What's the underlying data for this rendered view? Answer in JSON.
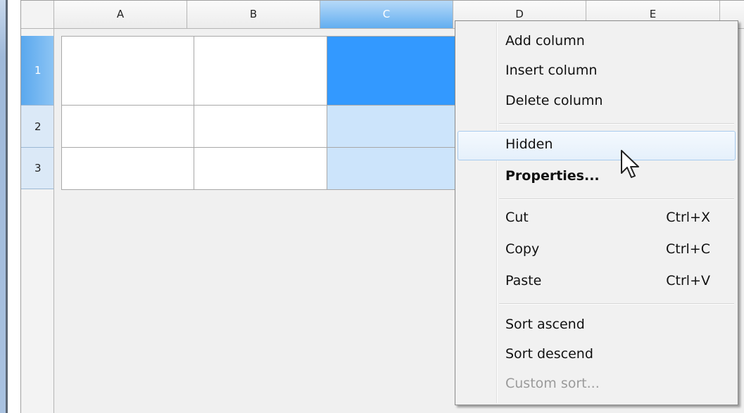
{
  "columns": [
    {
      "label": "A",
      "selected": false
    },
    {
      "label": "B",
      "selected": false
    },
    {
      "label": "C",
      "selected": true
    },
    {
      "label": "D",
      "selected": false
    },
    {
      "label": "E",
      "selected": false
    }
  ],
  "rows": [
    {
      "label": "1",
      "selected": true
    },
    {
      "label": "2",
      "selected": false
    },
    {
      "label": "3",
      "selected": false
    }
  ],
  "context_menu": {
    "hovered_item": "Hidden",
    "items": [
      {
        "label": "Add column"
      },
      {
        "label": "Insert column"
      },
      {
        "label": "Delete column"
      },
      {
        "label": "Hidden",
        "hover": true
      },
      {
        "label": "Properties...",
        "bold": true
      },
      {
        "label": "Cut",
        "shortcut": "Ctrl+X"
      },
      {
        "label": "Copy",
        "shortcut": "Ctrl+C"
      },
      {
        "label": "Paste",
        "shortcut": "Ctrl+V"
      },
      {
        "label": "Sort ascend"
      },
      {
        "label": "Sort descend"
      },
      {
        "label": "Custom sort...",
        "disabled": true
      }
    ]
  },
  "colors": {
    "selection_accent": "#3399ff",
    "selection_light": "#cce4fb",
    "menu_hover_border": "#a8cbee"
  },
  "icons": {
    "cursor": "arrow-cursor-icon"
  }
}
